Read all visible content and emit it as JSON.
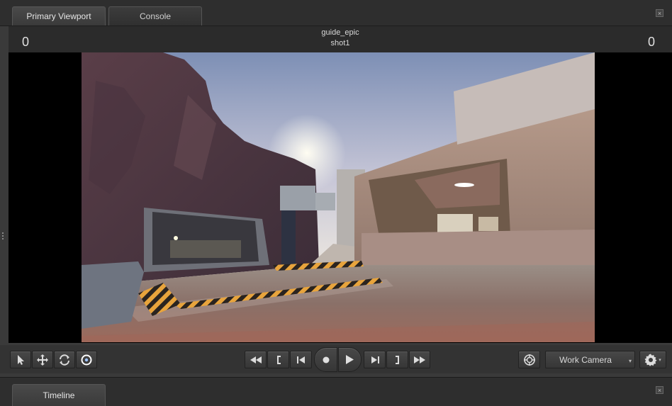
{
  "tabs": {
    "primary_viewport": "Primary Viewport",
    "console": "Console",
    "timeline": "Timeline"
  },
  "viewport": {
    "session_name": "guide_epic",
    "shot_name": "shot1",
    "frame_left": "0",
    "frame_right": "0"
  },
  "camera": {
    "selected": "Work Camera"
  },
  "icons": {
    "close": "×",
    "dropdown_arrow": "▾",
    "settings_arrow": "▾"
  },
  "colors": {
    "panel_bg": "#3a3a3a",
    "viewport_bg": "#000000",
    "accent_blue": "#9ec3ff"
  }
}
